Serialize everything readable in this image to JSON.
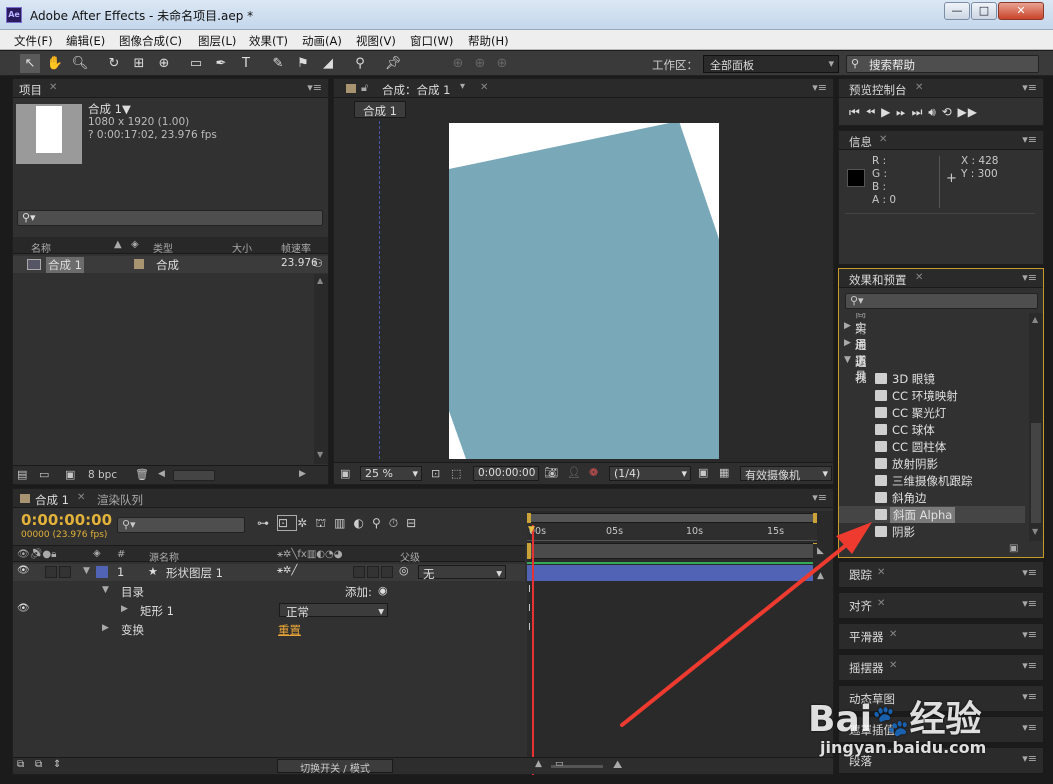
{
  "window": {
    "title": "Adobe After Effects - 未命名项目.aep *",
    "app_icon": "Ae",
    "buttons": [
      "—",
      "□",
      "✕"
    ]
  },
  "menu": [
    "文件(F)",
    "编辑(E)",
    "图像合成(C)",
    "图层(L)",
    "效果(T)",
    "动画(A)",
    "视图(V)",
    "窗口(W)",
    "帮助(H)"
  ],
  "toolbar": {
    "workspace_label": "工作区：",
    "workspace_value": "全部面板",
    "search_help": "搜索帮助"
  },
  "project": {
    "tab": "项目",
    "comp_name": "合成 1▼",
    "comp_size": "1080 x 1920 (1.00)",
    "comp_time": "? 0:00:17:02, 23.976 fps",
    "columns": {
      "name": "名称",
      "type": "类型",
      "size": "大小",
      "fps": "帧速率"
    },
    "item": {
      "name": "合成 1",
      "type": "合成",
      "fps": "23.976"
    },
    "bpc": "8 bpc"
  },
  "composition": {
    "tab": "合成：合成 1",
    "sub_tab": "合成 1",
    "zoom": "25 %",
    "time": "0:00:00:00",
    "resolution": "(1/4)",
    "camera": "有效摄像机"
  },
  "preview": {
    "tab": "预览控制台"
  },
  "info": {
    "tab": "信息",
    "r": "R :",
    "g": "G :",
    "b": "B :",
    "a": "A : 0",
    "x": "X : 428",
    "y": "Y : 300"
  },
  "effects": {
    "tab": "效果和预置",
    "partial": "商用",
    "categories": [
      {
        "label": "实用工具",
        "open": false
      },
      {
        "label": "通道",
        "open": false
      },
      {
        "label": "透视",
        "open": true
      }
    ],
    "items": [
      "3D 眼镜",
      "CC 环境映射",
      "CC 聚光灯",
      "CC 球体",
      "CC 圆柱体",
      "放射阴影",
      "三维摄像机跟踪",
      "斜角边",
      "斜面 Alpha",
      "阴影"
    ]
  },
  "side_panels": [
    "跟踪",
    "对齐",
    "平滑器",
    "摇摆器",
    "动态草图",
    "遮罩插值",
    "段落"
  ],
  "timeline": {
    "tab": "合成 1",
    "tab2": "渲染队列",
    "timecode": "0:00:00:00",
    "fps_line": "00000 (23.976 fps)",
    "col_source": "源名称",
    "col_parent": "父级",
    "col_num": "#",
    "layer": {
      "num": "1",
      "name": "形状图层 1",
      "parent": "无"
    },
    "contents": "目录",
    "add_label": "添加:",
    "shape": "矩形 1",
    "blend": "正常",
    "transform": "变换",
    "reset": "重置",
    "ruler": [
      "00s",
      "05s",
      "10s",
      "15s"
    ],
    "toggle_modes": "切换开关 / 模式"
  },
  "watermark": {
    "text": "jingyan.baidu.com"
  },
  "colors": {
    "comp_shape": "#79a8b8",
    "timecode": "#e2b23a",
    "layer_bar": "#5063b5",
    "playhead": "#e63232",
    "arrow": "#ef3b2f"
  }
}
